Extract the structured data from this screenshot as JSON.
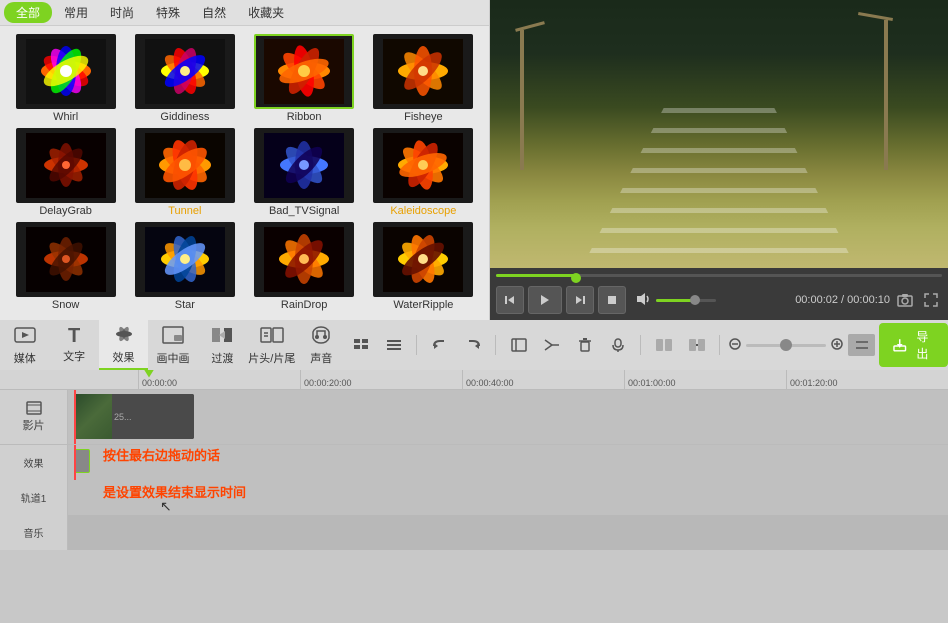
{
  "filterTabs": {
    "all": "全部",
    "common": "常用",
    "fashion": "时尚",
    "special": "特殊",
    "nature": "自然",
    "favorites": "收藏夹"
  },
  "effects": [
    {
      "id": "whirl",
      "label": "Whirl",
      "highlighted": false,
      "class": "flower-whirl"
    },
    {
      "id": "giddiness",
      "label": "Giddiness",
      "highlighted": false,
      "class": "flower-giddiness"
    },
    {
      "id": "ribbon",
      "label": "Ribbon",
      "highlighted": false,
      "class": "flower-ribbon"
    },
    {
      "id": "fisheye",
      "label": "Fisheye",
      "highlighted": false,
      "class": "flower-fisheye"
    },
    {
      "id": "delaygrab",
      "label": "DelayGrab",
      "highlighted": false,
      "class": "flower-delaygrab"
    },
    {
      "id": "tunnel",
      "label": "Tunnel",
      "highlighted": true,
      "class": "flower-tunnel"
    },
    {
      "id": "bad-tvsignal",
      "label": "Bad_TVSignal",
      "highlighted": false,
      "class": "flower-bad"
    },
    {
      "id": "kaleidoscope",
      "label": "Kaleidoscope",
      "highlighted": false,
      "class": "flower-kaleidoscope"
    },
    {
      "id": "snow",
      "label": "Snow",
      "highlighted": false,
      "class": "flower-snow"
    },
    {
      "id": "star",
      "label": "Star",
      "highlighted": false,
      "class": "flower-star"
    },
    {
      "id": "raindrop",
      "label": "RainDrop",
      "highlighted": false,
      "class": "flower-raindrop"
    },
    {
      "id": "waterripple",
      "label": "WaterRipple",
      "highlighted": false,
      "class": "flower-waterripple"
    }
  ],
  "transport": {
    "currentTime": "00:00:02",
    "totalTime": "00:00:10",
    "timeDisplay": "00:00:02 / 00:00:10"
  },
  "toolbar": {
    "exportLabel": "导出",
    "undoLabel": "↩",
    "redoLabel": "↪"
  },
  "toolItems": [
    {
      "id": "media",
      "label": "媒体",
      "icon": "▣"
    },
    {
      "id": "text",
      "label": "文字",
      "icon": "T"
    },
    {
      "id": "effects",
      "label": "效果",
      "icon": "✦"
    },
    {
      "id": "picInPic",
      "label": "画中画",
      "icon": "⧉"
    },
    {
      "id": "transition",
      "label": "过渡",
      "icon": "⇄"
    },
    {
      "id": "titleEnd",
      "label": "片头/片尾",
      "icon": "▶"
    },
    {
      "id": "audio",
      "label": "声音",
      "icon": "🎧"
    }
  ],
  "timeline": {
    "marks": [
      "00:00:00",
      "00:00:20:00",
      "00:00:40:00",
      "00:01:00:00",
      "00:01:20:00"
    ],
    "tracks": [
      {
        "id": "movie",
        "label": "影片"
      },
      {
        "id": "effects",
        "label": "效果"
      },
      {
        "id": "track1",
        "label": "轨道1"
      },
      {
        "id": "audio",
        "label": "音乐"
      }
    ]
  },
  "annotations": {
    "line1": "按住最右边拖动的话",
    "line2": "是设置效果结束显示时间"
  }
}
